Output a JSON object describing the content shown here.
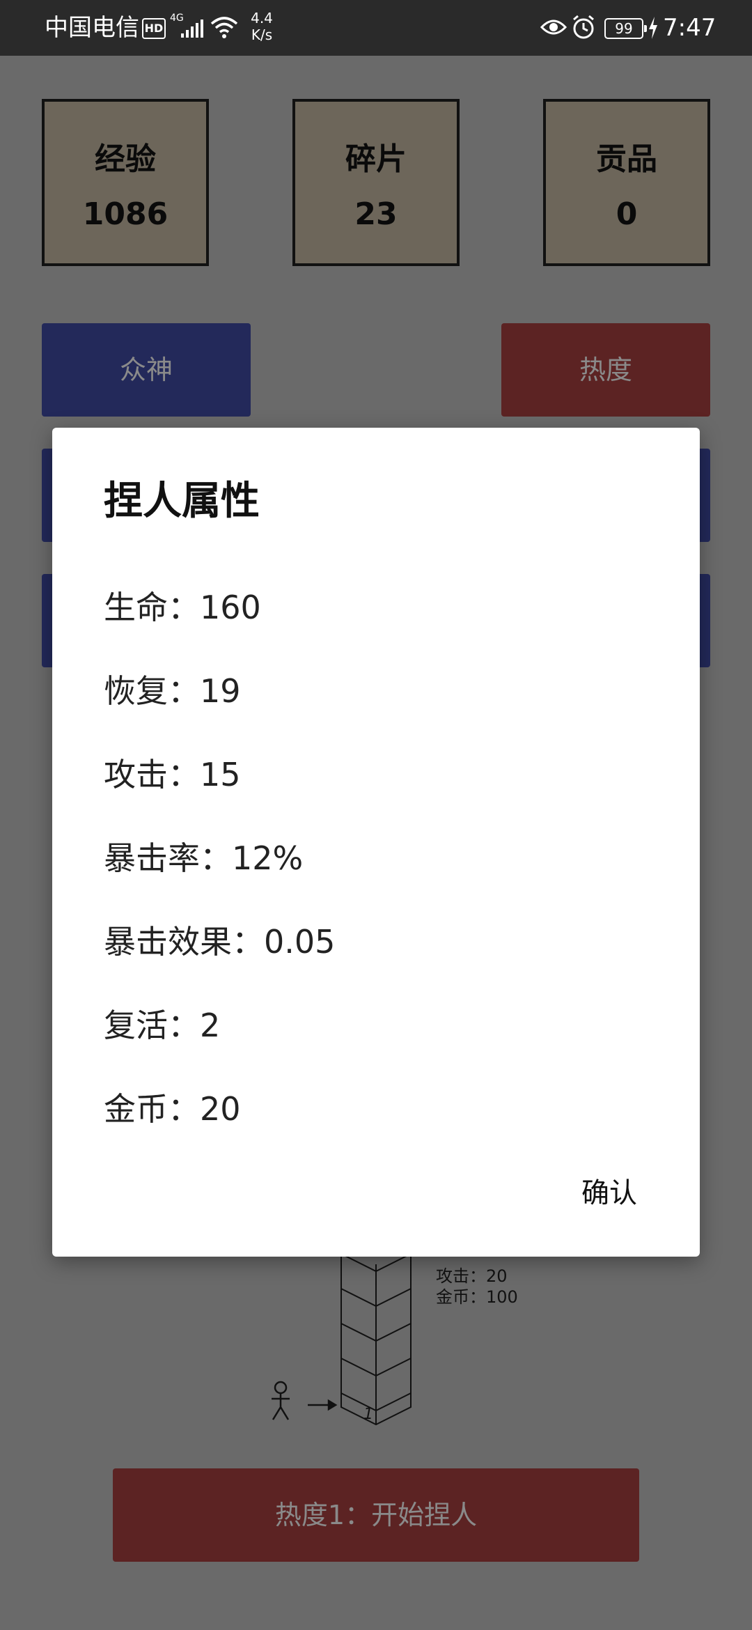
{
  "status_bar": {
    "carrier": "中国电信",
    "hd": "HD",
    "network": "4G",
    "speed_value": "4.4",
    "speed_unit": "K/s",
    "battery": "99",
    "time": "7:47"
  },
  "stats": [
    {
      "label": "经验",
      "value": "1086"
    },
    {
      "label": "碎片",
      "value": "23"
    },
    {
      "label": "贡品",
      "value": "0"
    }
  ],
  "buttons": {
    "gods": "众神",
    "heat": "热度",
    "start": "热度1：开始捏人"
  },
  "background_info": {
    "attack": "攻击：20",
    "gold": "金币：100"
  },
  "tower": {
    "level": "1"
  },
  "dialog": {
    "title": "捏人属性",
    "attributes": [
      "生命：160",
      "恢复：19",
      "攻击：15",
      "暴击率：12%",
      "暴击效果：0.05",
      "复活：2",
      "金币：20"
    ],
    "confirm": "确认"
  },
  "colors": {
    "status_bar": "#2a2a2a",
    "dim_background": "#6a6a6a",
    "stat_box": "#6d665a",
    "blue_button": "#23295a",
    "red_button": "#5c2323"
  }
}
